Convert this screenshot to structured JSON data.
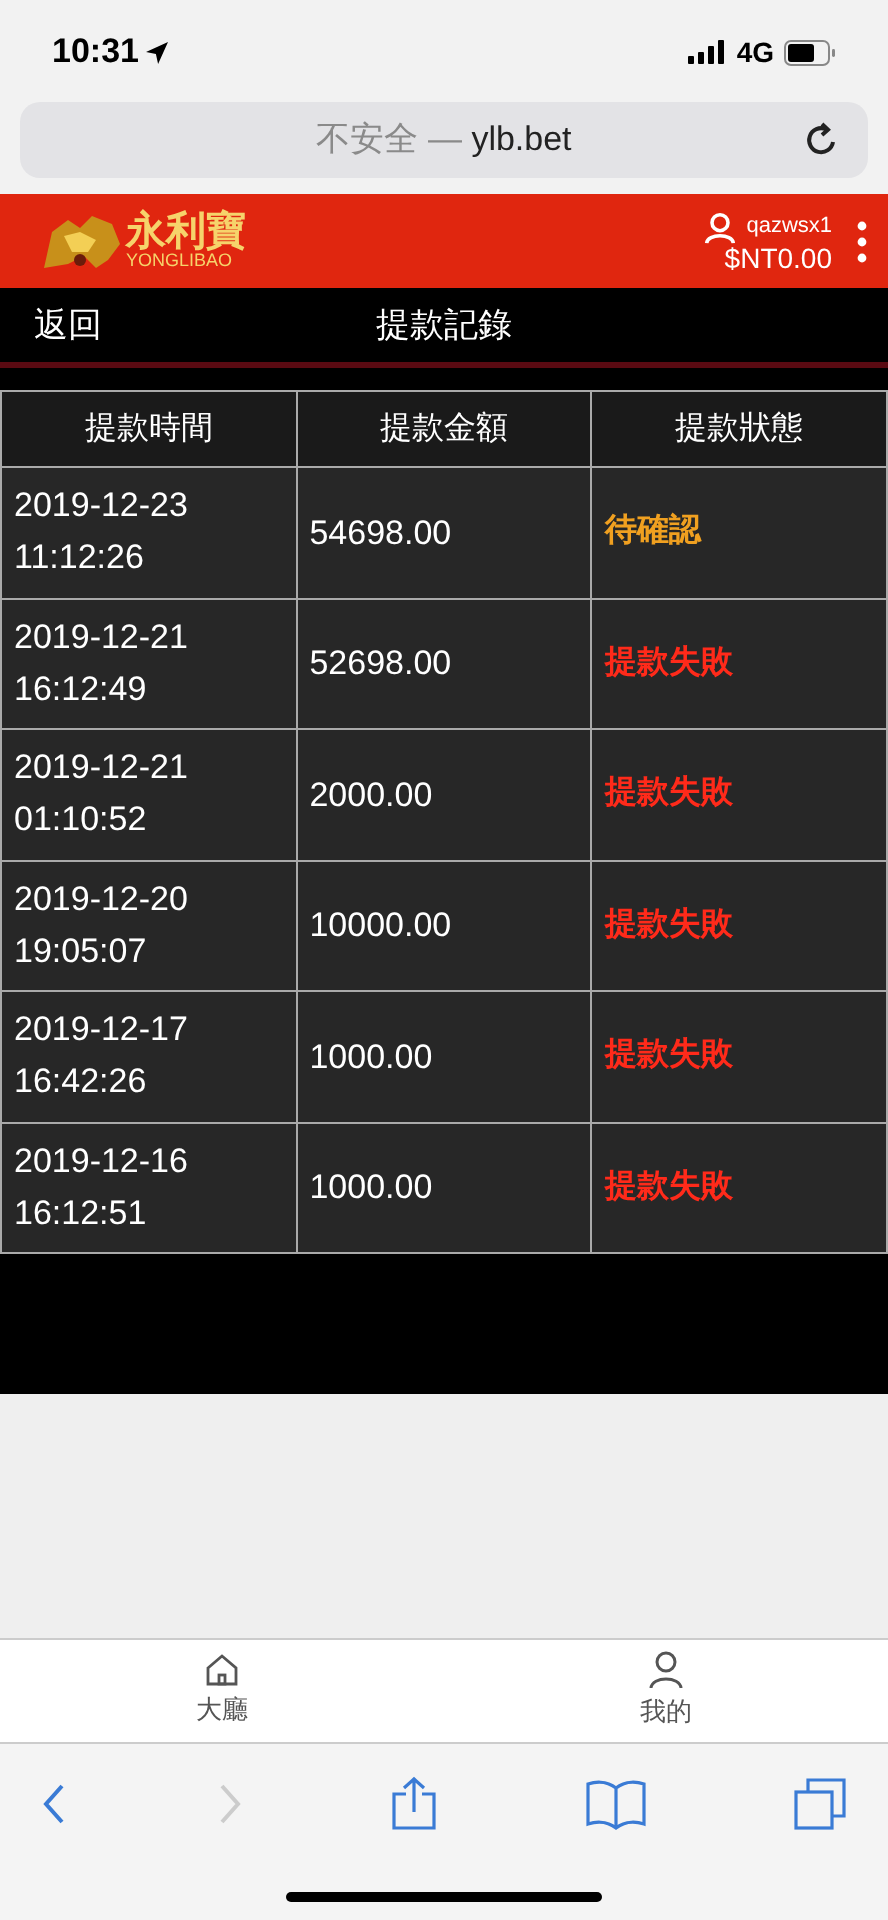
{
  "status_bar": {
    "time": "10:31",
    "network": "4G"
  },
  "address_bar": {
    "security": "不安全 —",
    "domain": "ylb.bet"
  },
  "header": {
    "logo_cn": "永利寶",
    "logo_en": "YONGLIBAO",
    "username": "qazwsx1",
    "balance": "$NT0.00"
  },
  "nav": {
    "back": "返回",
    "title": "提款記錄"
  },
  "table": {
    "columns": [
      "提款時間",
      "提款金額",
      "提款狀態"
    ],
    "rows": [
      {
        "date": "2019-12-23",
        "time": "11:12:26",
        "amount": "54698.00",
        "status": "待確認",
        "kind": "pending"
      },
      {
        "date": "2019-12-21",
        "time": "16:12:49",
        "amount": "52698.00",
        "status": "提款失敗",
        "kind": "failed"
      },
      {
        "date": "2019-12-21",
        "time": "01:10:52",
        "amount": "2000.00",
        "status": "提款失敗",
        "kind": "failed"
      },
      {
        "date": "2019-12-20",
        "time": "19:05:07",
        "amount": "10000.00",
        "status": "提款失敗",
        "kind": "failed"
      },
      {
        "date": "2019-12-17",
        "time": "16:42:26",
        "amount": "1000.00",
        "status": "提款失敗",
        "kind": "failed"
      },
      {
        "date": "2019-12-16",
        "time": "16:12:51",
        "amount": "1000.00",
        "status": "提款失敗",
        "kind": "failed"
      }
    ]
  },
  "tab_bar": [
    {
      "label": "大廳",
      "kind": "home"
    },
    {
      "label": "我的",
      "kind": "user"
    }
  ]
}
